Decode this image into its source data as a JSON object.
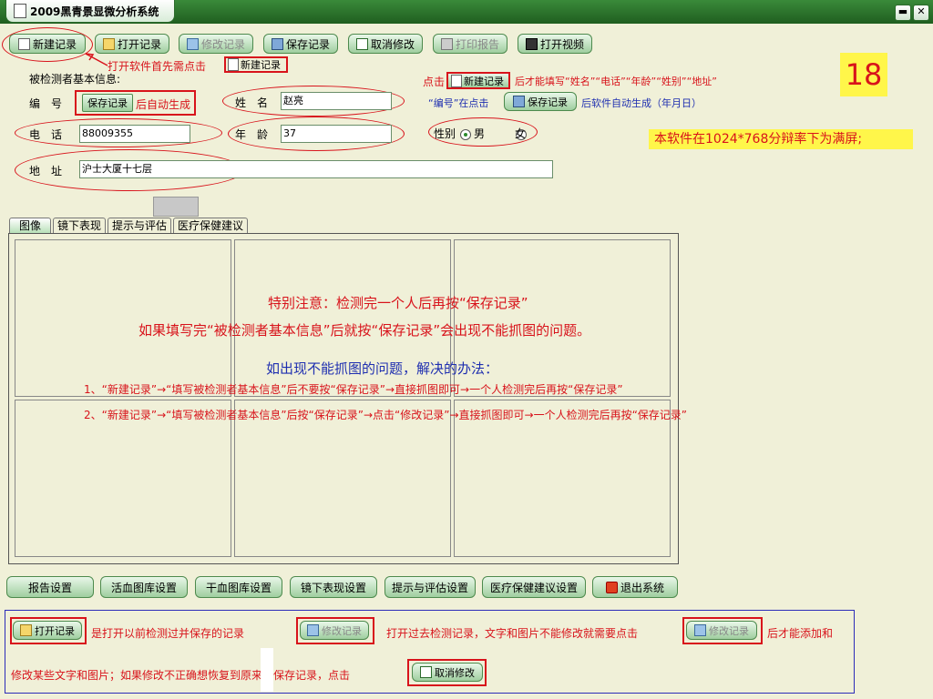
{
  "window": {
    "title": "2009黑青景显微分析系统",
    "minimize": "▬",
    "close": "✕"
  },
  "toolbar": {
    "new": "新建记录",
    "open": "打开记录",
    "edit": "修改记录",
    "save": "保存记录",
    "cancel": "取消修改",
    "print": "打印报告",
    "video": "打开视频"
  },
  "notes": {
    "first_click": "打开软件首先需点击",
    "first_click_btn": "新建记录",
    "click_prefix": "点击",
    "click_btn": "新建记录",
    "click_suffix": "后才能填写“姓名”“电话”“年龄”“姓别”“地址”",
    "id_prefix": "“编号”在点击",
    "id_btn": "保存记录",
    "id_suffix": "后软件自动生成（年月日）",
    "page_number": "18",
    "resolution": "本软件在1024*768分辩率下为满屏;"
  },
  "form": {
    "section_label": "被检测者基本信息:",
    "id_label": "编　号",
    "id_btn": "保存记录",
    "id_auto": "后自动生成",
    "name_label": "姓　名",
    "name_value": "赵亮",
    "phone_label": "电　话",
    "phone_value": "88009355",
    "age_label": "年　龄",
    "age_value": "37",
    "gender_label": "性别",
    "gender_male": "男",
    "gender_female": "女",
    "address_label": "地　址",
    "address_value": "沪士大厦十七层"
  },
  "tabs": [
    "图像",
    "镜下表现",
    "提示与评估",
    "医疗保健建议"
  ],
  "overlay": {
    "line1": "特别注意：检测完一个人后再按“保存记录”",
    "line2": "如果填写完“被检测者基本信息”后就按“保存记录”会出现不能抓图的问题。",
    "line3": "如出现不能抓图的问题，解决的办法：",
    "line4": "1、“新建记录”→“填写被检测者基本信息”后不要按“保存记录”→直接抓图即可→一个人检测完后再按“保存记录”",
    "line5": "2、“新建记录”→“填写被检测者基本信息”后按“保存记录”→点击“修改记录”→直接抓图即可→一个人检测完后再按“保存记录”"
  },
  "bottom_buttons": {
    "report": "报告设置",
    "live_blood": "活血图库设置",
    "dry_blood": "干血图库设置",
    "microscope": "镜下表现设置",
    "hints": "提示与评估设置",
    "medical": "医疗保健建议设置",
    "exit": "退出系统"
  },
  "help": {
    "open_btn": "打开记录",
    "open_desc": "是打开以前检测过并保存的记录",
    "edit_btn": "修改记录",
    "edit_desc": "打开过去检测记录，文字和图片不能修改就需要点击",
    "edit_btn2": "修改记录",
    "edit_suffix": "后才能添加和",
    "line2": "修改某些文字和图片；如果修改不正确想恢复到原来的保存记录，点击",
    "cancel_btn": "取消修改"
  }
}
